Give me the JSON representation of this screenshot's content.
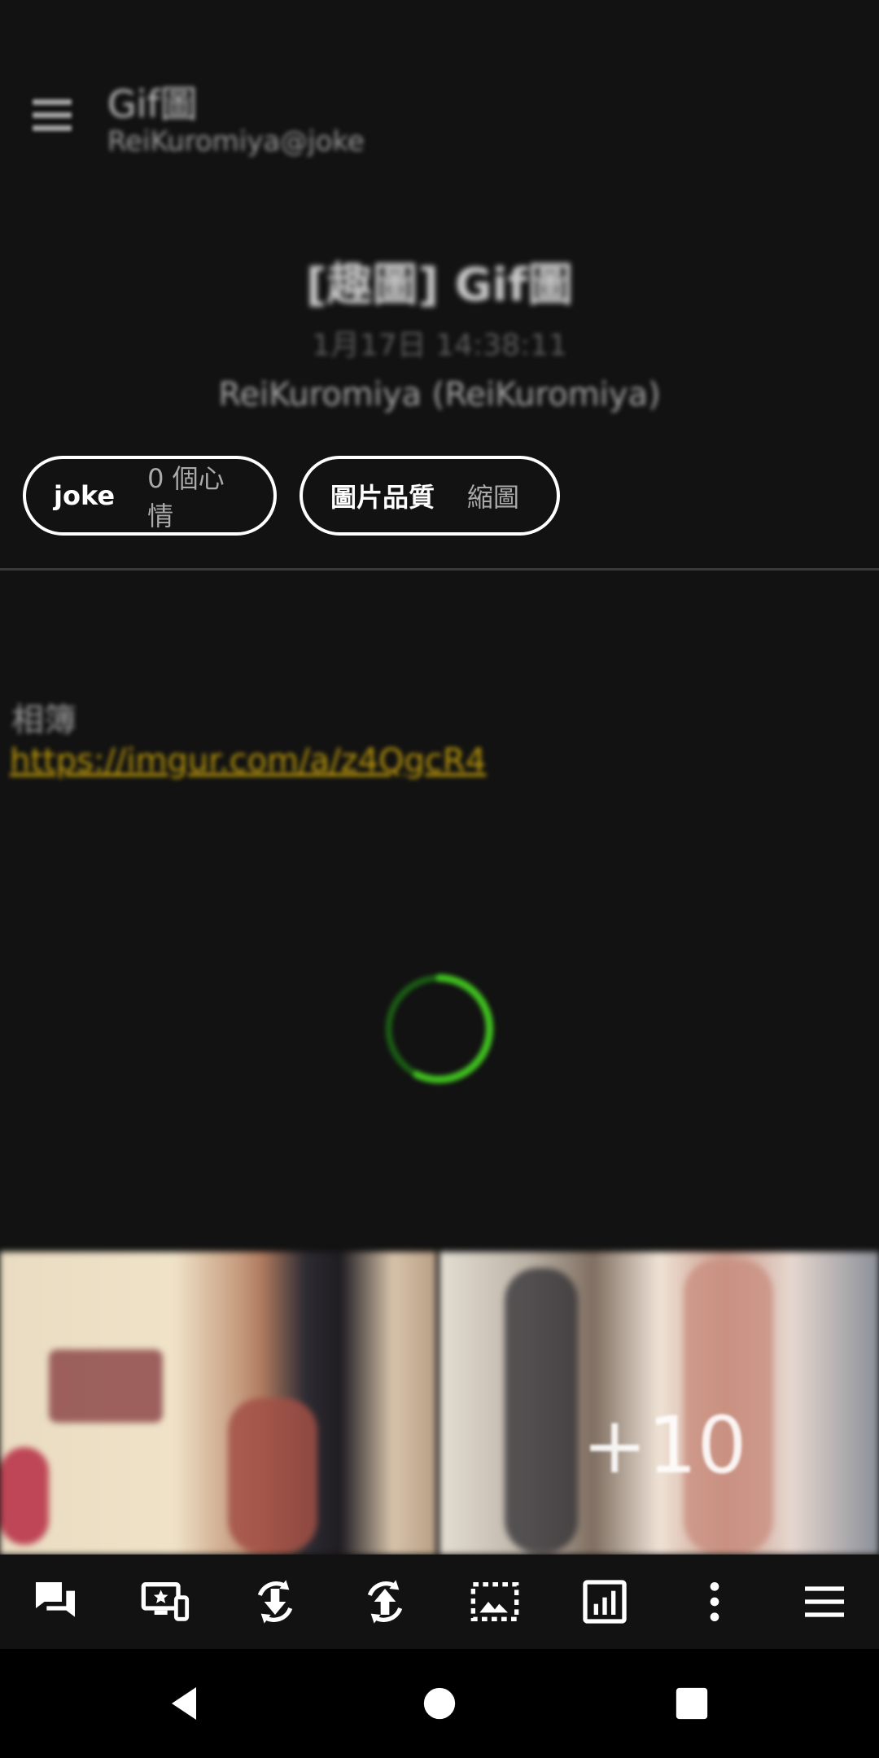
{
  "app_bar": {
    "title": "Gif圖",
    "subtitle": "ReiKuromiya@joke"
  },
  "post": {
    "title": "[趣圖] Gif圖",
    "time": "1月17日 14:38:11",
    "author": "ReiKuromiya (ReiKuromiya)"
  },
  "chips": [
    {
      "key": "joke",
      "value": "0 個心情"
    },
    {
      "key": "圖片品質",
      "value": "縮圖"
    }
  ],
  "body": {
    "label": "相簿",
    "link": "https://imgur.com/a/z4QgcR4"
  },
  "spinner_color": "#3fbf1f",
  "media": {
    "more_count": "+10"
  },
  "toolbar": {
    "icons": [
      "comments-icon",
      "devices-star-icon",
      "rotate-download-icon",
      "rotate-upload-icon",
      "image-crop-icon",
      "stats-icon",
      "more-vert-icon",
      "menu-icon"
    ]
  },
  "navbar": {
    "icons": [
      "back-icon",
      "home-icon",
      "recents-icon"
    ]
  }
}
